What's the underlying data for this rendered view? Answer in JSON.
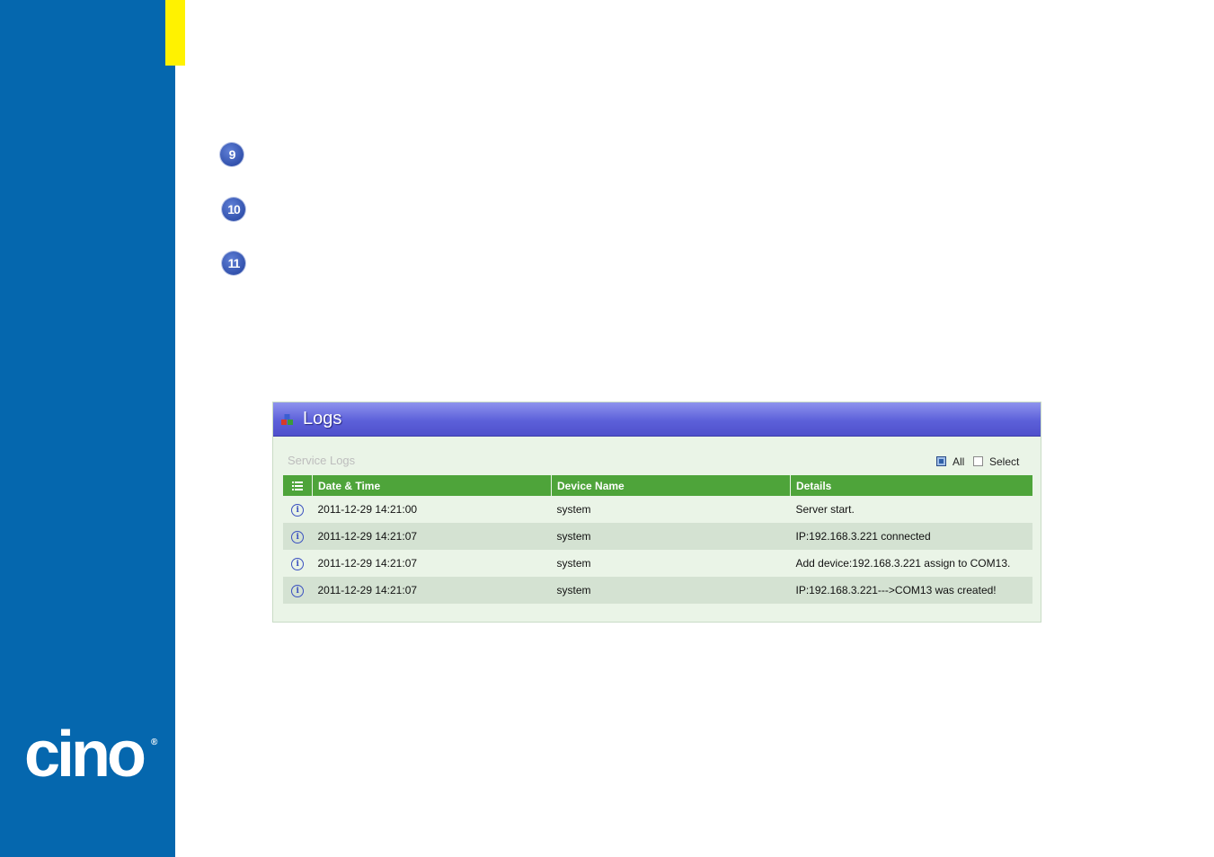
{
  "steps": [
    "9",
    "10",
    "11"
  ],
  "brand": {
    "logo_text": "cino",
    "registered": "®"
  },
  "panel": {
    "title": "Logs",
    "section_label": "Service Logs",
    "filters": {
      "all_label": "All",
      "all_checked": true,
      "select_label": "Select",
      "select_checked": false
    }
  },
  "table": {
    "columns": [
      "Date & Time",
      "Device Name",
      "Details"
    ],
    "rows": [
      {
        "icon": "info-icon",
        "datetime": "2011-12-29 14:21:00",
        "device": "system",
        "details": "Server start."
      },
      {
        "icon": "info-icon",
        "datetime": "2011-12-29 14:21:07",
        "device": "system",
        "details": "IP:192.168.3.221 connected"
      },
      {
        "icon": "info-icon",
        "datetime": "2011-12-29 14:21:07",
        "device": "system",
        "details": "Add device:192.168.3.221 assign to COM13."
      },
      {
        "icon": "info-icon",
        "datetime": "2011-12-29 14:21:07",
        "device": "system",
        "details": "IP:192.168.3.221--->COM13 was created!"
      }
    ]
  },
  "colors": {
    "sidebar": "#0567ae",
    "accent_yellow": "#fff200",
    "header_purple": "#5c60d9",
    "table_header_green": "#4ea43a"
  }
}
